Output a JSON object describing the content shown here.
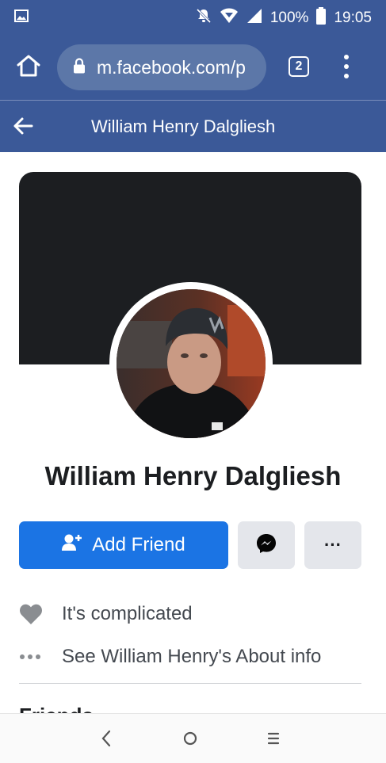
{
  "status_bar": {
    "battery": "100%",
    "time": "19:05"
  },
  "browser": {
    "url": "m.facebook.com/p",
    "tab_count": "2"
  },
  "header": {
    "title": "William Henry Dalgliesh"
  },
  "profile": {
    "name": "William Henry Dalgliesh",
    "add_friend_label": "Add Friend",
    "more_label": "···",
    "relationship": "It's complicated",
    "about_link": "See William Henry's About info",
    "friends_heading": "Friends"
  },
  "colors": {
    "brand": "#3b5998",
    "primary_button": "#1b74e4",
    "secondary_button": "#e4e6eb"
  }
}
